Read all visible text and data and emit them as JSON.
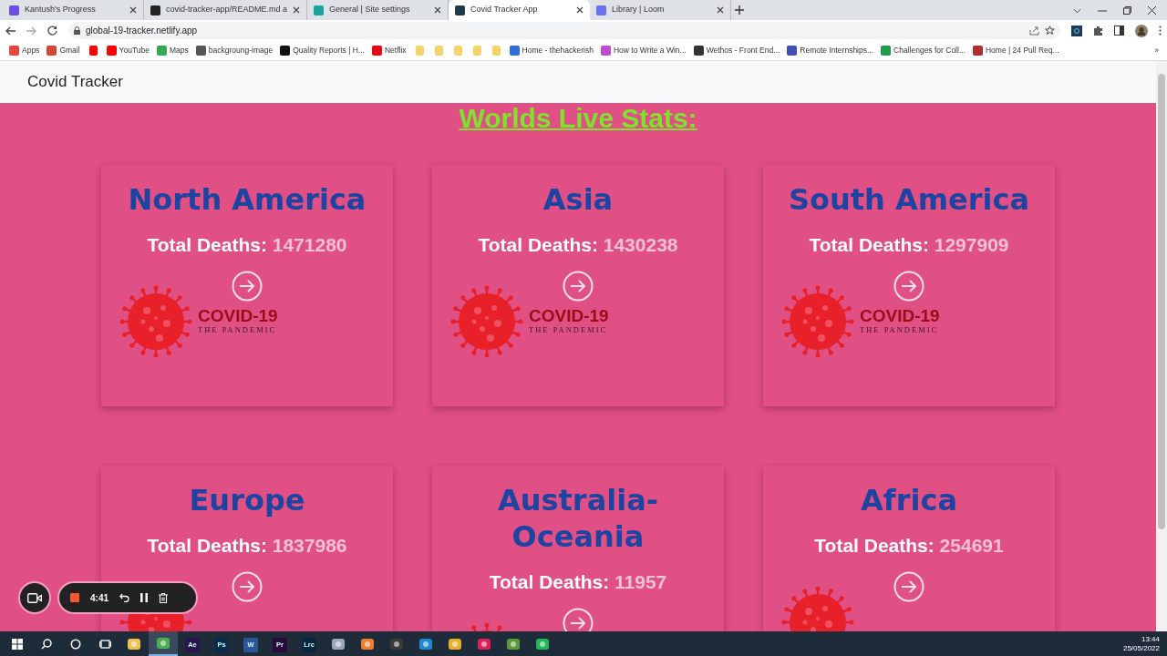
{
  "tabs": [
    {
      "title": "Kantush's Progress",
      "color": "#6b4ce6",
      "selected": false
    },
    {
      "title": "covid-tracker-app/README.md a",
      "color": "#222222",
      "selected": false
    },
    {
      "title": "General | Site settings",
      "color": "#1aa59a",
      "selected": false
    },
    {
      "title": "Covid Tracker App",
      "color": "#1f3a4a",
      "selected": true
    },
    {
      "title": "Library | Loom",
      "color": "#6e6ef0",
      "selected": false
    }
  ],
  "address": "global-19-tracker.netlify.app",
  "bookmarks": [
    {
      "label": "Apps",
      "color": "#e8453c"
    },
    {
      "label": "Gmail",
      "color": "#d44638"
    },
    {
      "color": "#ff0000"
    },
    {
      "label": "YouTube",
      "color": "#ff0000"
    },
    {
      "label": "Maps",
      "color": "#34a853"
    },
    {
      "label": "backgroung-image",
      "color": "#555555"
    },
    {
      "label": "Quality Reports | H...",
      "color": "#111111"
    },
    {
      "label": "Netflix",
      "color": "#e50914"
    },
    {
      "color": "#f5d36b"
    },
    {
      "color": "#f5d36b"
    },
    {
      "color": "#f5d36b"
    },
    {
      "color": "#f5d36b"
    },
    {
      "color": "#f5d36b"
    },
    {
      "label": "Home - thehackerish",
      "color": "#2f6fd8"
    },
    {
      "label": "How to Write a Win...",
      "color": "#c04ad0"
    },
    {
      "label": "Wethos - Front End...",
      "color": "#333333"
    },
    {
      "label": "Remote Internships...",
      "color": "#3f51b5"
    },
    {
      "label": "Challenges for Coll...",
      "color": "#1e9e4a"
    },
    {
      "label": "Home | 24 Pull Req...",
      "color": "#b03030"
    }
  ],
  "more_bookmarks": "»",
  "brand": "Covid Tracker",
  "heading": "Worlds Live Stats:",
  "cards": [
    {
      "region": "North America",
      "label": "Total Deaths:",
      "deaths": "1471280",
      "logo_title": "COVID-19",
      "logo_subtitle": "THE PANDEMIC"
    },
    {
      "region": "Asia",
      "label": "Total Deaths:",
      "deaths": "1430238",
      "logo_title": "COVID-19",
      "logo_subtitle": "THE PANDEMIC"
    },
    {
      "region": "South America",
      "label": "Total Deaths:",
      "deaths": "1297909",
      "logo_title": "COVID-19",
      "logo_subtitle": "THE PANDEMIC"
    },
    {
      "region": "Europe",
      "label": "Total Deaths:",
      "deaths": "1837986"
    },
    {
      "region": "Australia-Oceania",
      "label": "Total Deaths:",
      "deaths": "11957"
    },
    {
      "region": "Africa",
      "label": "Total Deaths:",
      "deaths": "254691"
    }
  ],
  "recorder": {
    "time": "4:41"
  },
  "taskbar": [
    {
      "kind": "search",
      "selected": false
    },
    {
      "kind": "cortana",
      "selected": false
    },
    {
      "kind": "taskview",
      "selected": false
    },
    {
      "kind": "app",
      "color": "#f2c14e",
      "selected": false
    },
    {
      "kind": "app",
      "color": "#4caf50",
      "selected": true
    },
    {
      "kind": "app",
      "color": "#2a1450",
      "label": "Ae",
      "selected": false
    },
    {
      "kind": "app",
      "color": "#0c2a4a",
      "label": "Ps",
      "selected": false
    },
    {
      "kind": "app",
      "color": "#2b579a",
      "label": "W",
      "selected": false
    },
    {
      "kind": "app",
      "color": "#2a0a3a",
      "label": "Pr",
      "selected": false
    },
    {
      "kind": "app",
      "color": "#0a2540",
      "label": "Lrc",
      "selected": false
    },
    {
      "kind": "app",
      "color": "#9aa8b8",
      "selected": false
    },
    {
      "kind": "app",
      "color": "#f08030",
      "selected": false
    },
    {
      "kind": "app",
      "color": "#3a3a3a",
      "selected": false
    },
    {
      "kind": "app",
      "color": "#1f8ad2",
      "selected": false
    },
    {
      "kind": "app",
      "color": "#e8b02a",
      "selected": false
    },
    {
      "kind": "app",
      "color": "#e01e5a",
      "selected": false
    },
    {
      "kind": "app",
      "color": "#5a9a3a",
      "selected": false
    },
    {
      "kind": "app",
      "color": "#1db954",
      "selected": false
    }
  ],
  "clock": {
    "time": "13:44",
    "date": "25/05/2022"
  }
}
